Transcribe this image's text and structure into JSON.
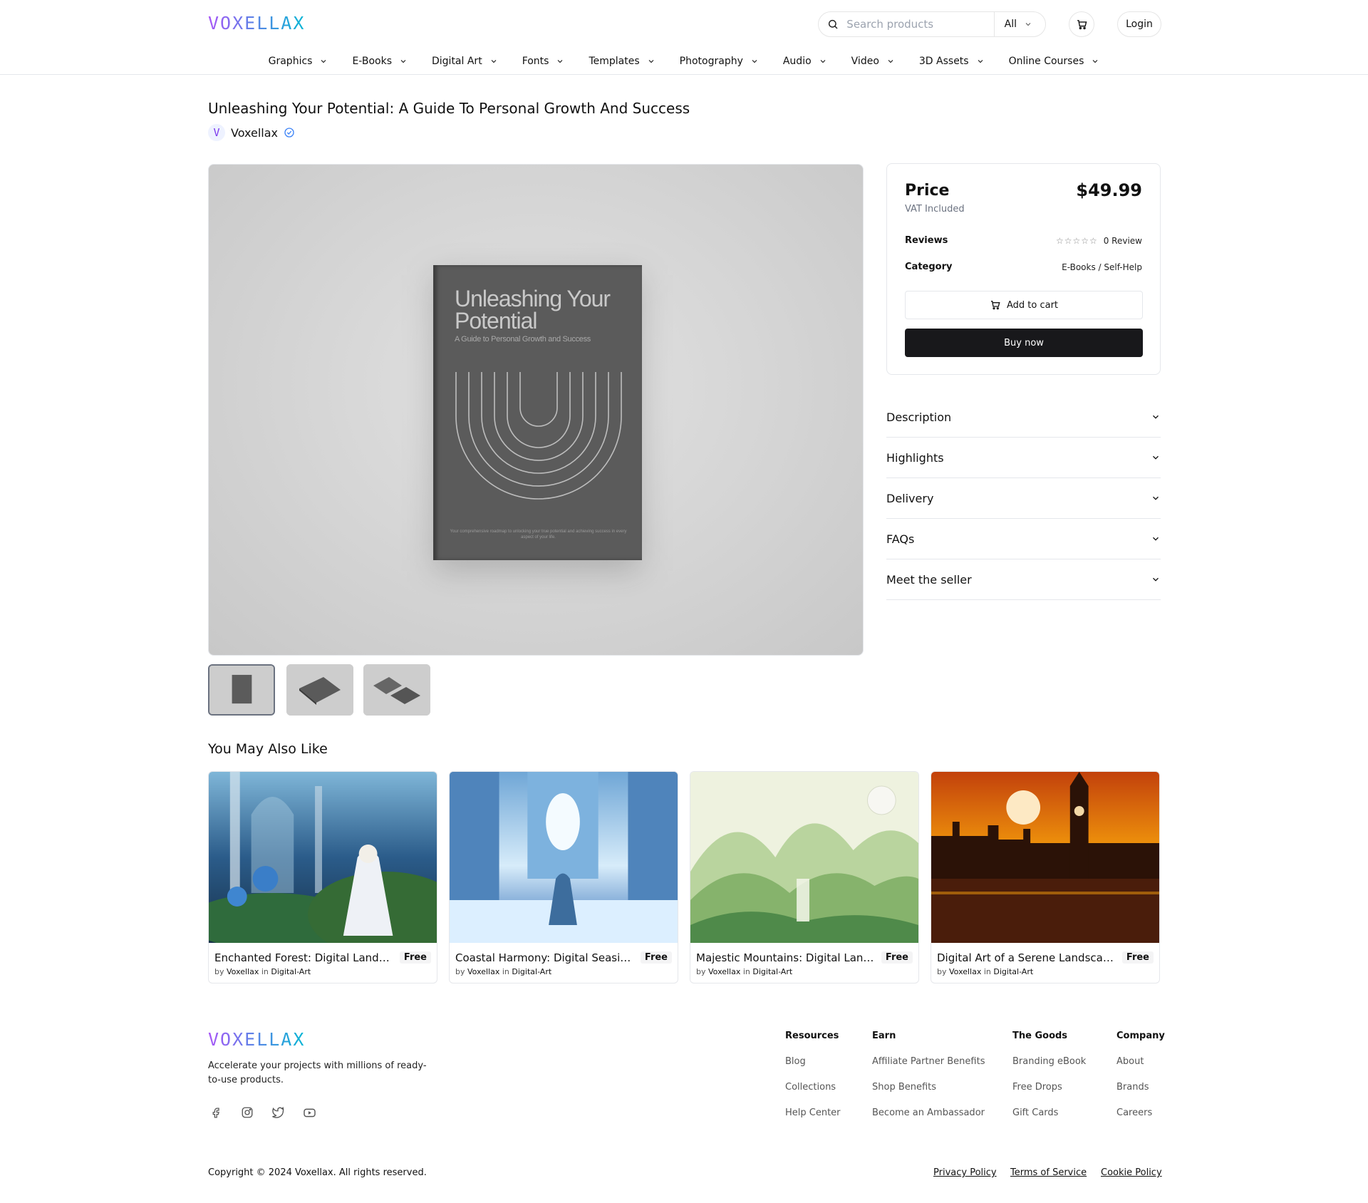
{
  "header": {
    "brand": "VOXELLAX",
    "search_placeholder": "Search products",
    "search_category": "All",
    "login_label": "Login"
  },
  "nav": [
    "Graphics",
    "E-Books",
    "Digital Art",
    "Fonts",
    "Templates",
    "Photography",
    "Audio",
    "Video",
    "3D Assets",
    "Online Courses"
  ],
  "product": {
    "title": "Unleashing Your Potential: A Guide To Personal Growth And Success",
    "seller": "Voxellax",
    "seller_logo_letter": "V",
    "cover_title": "Unleashing Your Potential",
    "cover_subtitle": "A Guide to Personal Growth and Success",
    "cover_footer": "Your comprehensive roadmap to unlocking your true potential and achieving success in every aspect of your life."
  },
  "pricing": {
    "price_label": "Price",
    "price": "$49.99",
    "vat": "VAT Included",
    "reviews_label": "Reviews",
    "stars": "☆☆☆☆☆",
    "review_count": "0 Review",
    "category_label": "Category",
    "category": "E-Books / Self-Help",
    "add_to_cart": "Add to cart",
    "buy_now": "Buy now"
  },
  "accordion": [
    "Description",
    "Highlights",
    "Delivery",
    "FAQs",
    "Meet the seller"
  ],
  "related": {
    "title": "You May Also Like",
    "items": [
      {
        "name": "Enchanted Forest: Digital Landscape Art",
        "price": "Free",
        "by": "by",
        "seller": "Voxellax",
        "in": "in",
        "category": "Digital-Art"
      },
      {
        "name": "Coastal Harmony: Digital Seaside Art",
        "price": "Free",
        "by": "by",
        "seller": "Voxellax",
        "in": "in",
        "category": "Digital-Art"
      },
      {
        "name": "Majestic Mountains: Digital Landscape",
        "price": "Free",
        "by": "by",
        "seller": "Voxellax",
        "in": "in",
        "category": "Digital-Art"
      },
      {
        "name": "Digital Art of a Serene Landscape",
        "price": "Free",
        "by": "by",
        "seller": "Voxellax",
        "in": "in",
        "category": "Digital-Art"
      }
    ]
  },
  "footer": {
    "brand": "VOXELLAX",
    "tagline": "Accelerate your projects with millions of ready-to-use products.",
    "columns": [
      {
        "title": "Resources",
        "links": [
          "Blog",
          "Collections",
          "Help Center"
        ]
      },
      {
        "title": "Earn",
        "links": [
          "Affiliate Partner Benefits",
          "Shop Benefits",
          "Become an Ambassador"
        ]
      },
      {
        "title": "The Goods",
        "links": [
          "Branding eBook",
          "Free Drops",
          "Gift Cards"
        ]
      },
      {
        "title": "Company",
        "links": [
          "About",
          "Brands",
          "Careers"
        ]
      }
    ],
    "copyright": "Copyright © 2024 Voxellax. All rights reserved.",
    "legal": [
      "Privacy Policy",
      "Terms of Service",
      "Cookie Policy"
    ],
    "social_icons": [
      "facebook-icon",
      "instagram-icon",
      "twitter-icon",
      "youtube-icon"
    ]
  }
}
